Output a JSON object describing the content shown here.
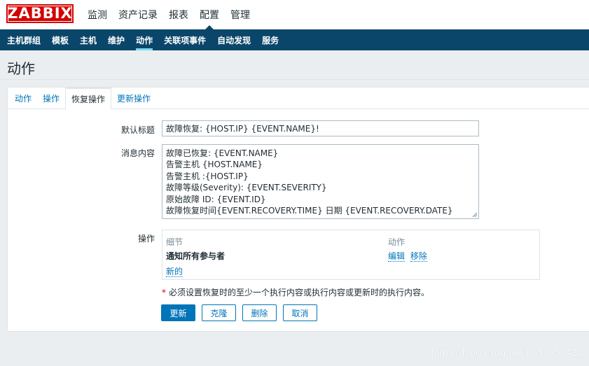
{
  "brand": {
    "logo_text": "ZABBIX",
    "color": "#d40000"
  },
  "main_menu": {
    "items": [
      {
        "label": "监测"
      },
      {
        "label": "资产记录"
      },
      {
        "label": "报表"
      },
      {
        "label": "配置",
        "active": true
      },
      {
        "label": "管理"
      }
    ]
  },
  "sub_menu": {
    "items": [
      {
        "label": "主机群组"
      },
      {
        "label": "模板"
      },
      {
        "label": "主机"
      },
      {
        "label": "维护"
      },
      {
        "label": "动作",
        "active": true
      },
      {
        "label": "关联项事件"
      },
      {
        "label": "自动发现"
      },
      {
        "label": "服务"
      }
    ]
  },
  "page": {
    "title": "动作"
  },
  "tabs": [
    {
      "label": "动作"
    },
    {
      "label": "操作"
    },
    {
      "label": "恢复操作",
      "active": true
    },
    {
      "label": "更新操作"
    }
  ],
  "form": {
    "default_subject_label": "默认标题",
    "default_subject_value": "故障恢复: {HOST.IP} {EVENT.NAME}!",
    "message_label": "消息内容",
    "message_lines": [
      "故障已恢复: {EVENT.NAME}",
      "告警主机 {HOST.NAME}",
      "告警主机 :{HOST.IP}",
      "故障等级(Severity): {EVENT.SEVERITY}",
      "原始故障 ID: {EVENT.ID}",
      "故障恢复时间{EVENT.RECOVERY.TIME} 日期 {EVENT.RECOVERY.DATE}"
    ],
    "operations_label": "操作",
    "operations_table": {
      "col_details": "细节",
      "col_action": "动作",
      "row_detail": "通知所有参与者",
      "row_edit": "编辑",
      "row_remove": "移除",
      "new_link": "新的"
    },
    "required_star": "*",
    "required_note": "必须设置恢复时的至少一个执行内容或执行内容或更新时的执行内容。"
  },
  "buttons": {
    "update": "更新",
    "clone": "克隆",
    "delete": "删除",
    "cancel": "取消"
  },
  "watermark": "https://blog.csdn.net/u852058422",
  "colors": {
    "accent": "#0275b8",
    "subnav_bg": "#0a466a",
    "page_bg": "#ebeef0"
  }
}
